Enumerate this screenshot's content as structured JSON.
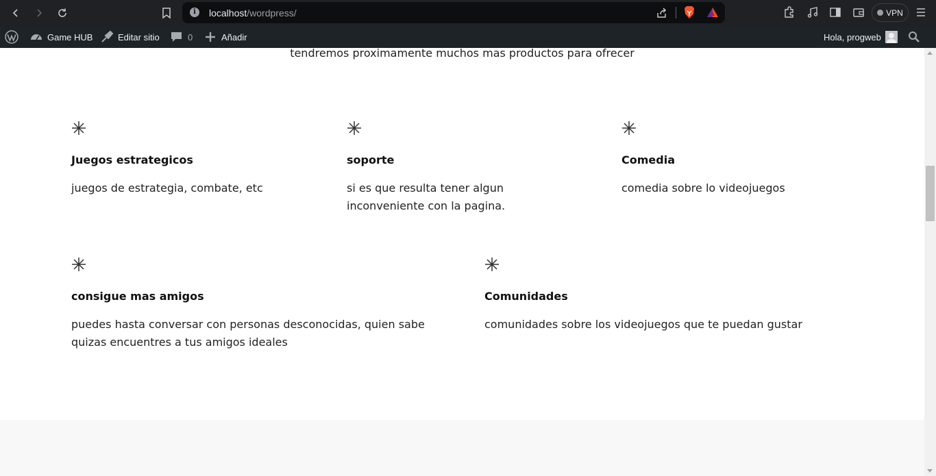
{
  "browser": {
    "url_host": "localhost",
    "url_path": "/wordpress/",
    "vpn_label": "VPN"
  },
  "admin_bar": {
    "site_name": "Game HUB",
    "edit_site": "Editar sitio",
    "comments_count": "0",
    "add_new": "Añadir",
    "greeting": "Hola, progweb"
  },
  "content": {
    "intro": "tendremos proximamente muchos mas productos para ofrecer",
    "row1": [
      {
        "title": "Juegos estrategicos",
        "text": "juegos de estrategia, combate, etc"
      },
      {
        "title": "soporte",
        "text": "si es que resulta tener algun inconveniente con la pagina."
      },
      {
        "title": "Comedia",
        "text": "comedia sobre lo videojuegos"
      }
    ],
    "row2": [
      {
        "title": "consigue mas amigos",
        "text": "puedes hasta conversar con personas desconocidas, quien sabe quizas encuentres a tus amigos ideales"
      },
      {
        "title": "Comunidades",
        "text": "comunidades sobre los videojuegos que te puedan gustar"
      }
    ]
  },
  "icons": {
    "feature": "asterisk-icon",
    "colors": {
      "admin_bar_bg": "#1d2327",
      "browser_bg": "#202124",
      "page_bg": "#ffffff"
    }
  }
}
